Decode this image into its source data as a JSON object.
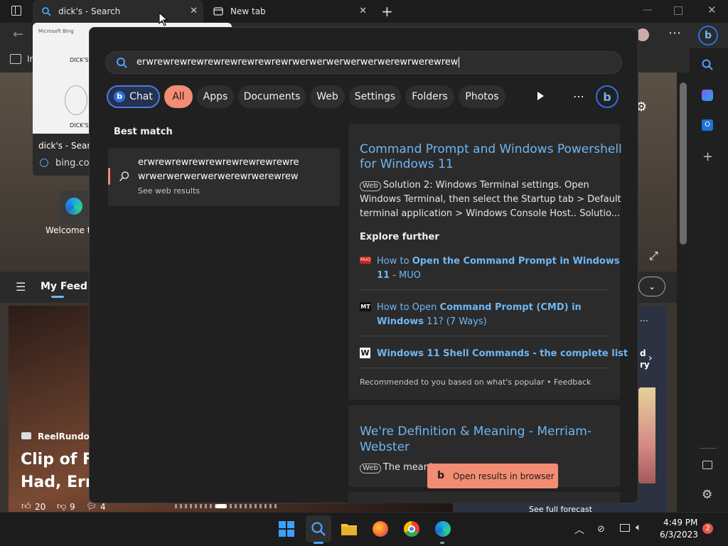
{
  "browser": {
    "tabs": [
      {
        "title": "dick's - Search"
      },
      {
        "title": "New tab"
      }
    ],
    "preview": {
      "title": "dick's - Search",
      "url": "bing.com",
      "thumb_heading": "DICK'S S",
      "thumb_footer": "DICK'S Sp"
    },
    "favorites_label": "In",
    "tile_label": "Welcome to",
    "feed": {
      "label": "My Feed",
      "source": "ReelRundown",
      "headline_line1": "Clip of Fl",
      "headline_line2": "Had, Erm",
      "likes": "20",
      "dislikes": "9",
      "comments": "4",
      "side_text1": "d",
      "side_text2": "ry",
      "side_button": "See full forecast"
    }
  },
  "search": {
    "query": "erwrewrewrewrewrewrewrewrewrwerwerwerwerwerwerewrwerewrew",
    "filters": [
      "Chat",
      "All",
      "Apps",
      "Documents",
      "Web",
      "Settings",
      "Folders",
      "Photos"
    ],
    "best_match_heading": "Best match",
    "best_match": {
      "line1": "erwrewrewrewrewrewrewrewrewre",
      "line2": "wrwerwerwerwerwerewrwerewrew",
      "sub": "See web results"
    },
    "result": {
      "title_line1": "Command Prompt and Windows Powershell",
      "title_line2": "for Windows 11",
      "tag": "Web",
      "snippet_line1": "Solution 2: Windows Terminal settings. Open",
      "snippet_line2": "Windows Terminal, then select the Startup tab > Default",
      "snippet_line3": "terminal application > Windows Console Host.. Solutio...",
      "explore_heading": "Explore further",
      "explore": [
        {
          "badge": "MUO",
          "pre": "How to ",
          "bold": "Open the Command Prompt in Windows",
          "bold2": "11",
          "post": " - MUO"
        },
        {
          "badge": "MT",
          "pre": "How to Open ",
          "bold": "Command Prompt (CMD) in",
          "bold2": "Windows",
          "post": " 11? (7 Ways)"
        },
        {
          "badge": "W",
          "pre": "",
          "bold": "Windows 11 Shell Commands - the complete list",
          "bold2": "",
          "post": ""
        }
      ],
      "footer": "Recommended to you based on what's popular • Feedback"
    },
    "result2": {
      "title_line1": "We're Definition & Meaning - Merriam-",
      "title_line2": "Webster",
      "tag": "Web",
      "snippet": "The meani"
    },
    "open_button": "Open results in browser"
  },
  "taskbar": {
    "time": "4:49 PM",
    "date": "6/3/2023",
    "notifications": "2"
  },
  "colors": {
    "accent": "#f28c72",
    "link": "#6fb6f3",
    "chat_border": "#4c7bd9"
  }
}
